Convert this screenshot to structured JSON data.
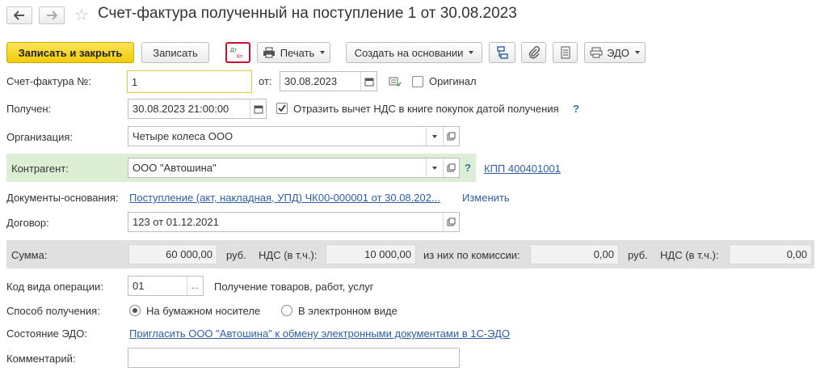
{
  "window": {
    "title": "Счет-фактура полученный на поступление 1 от 30.08.2023"
  },
  "toolbar": {
    "save_close": "Записать и закрыть",
    "save": "Записать",
    "dt_kt": "Дт Кт",
    "print": "Печать",
    "create_based": "Создать на основании",
    "edo": "ЭДО"
  },
  "form": {
    "invoice_number_label": "Счет-фактура №:",
    "invoice_number": "1",
    "from_label": "от:",
    "invoice_date": "30.08.2023",
    "original_label": "Оригинал",
    "original_checked": false,
    "received_label": "Получен:",
    "received_datetime": "30.08.2023 21:00:00",
    "vat_deduction_label": "Отразить вычет НДС в книге покупок датой получения",
    "vat_deduction_checked": true,
    "organization_label": "Организация:",
    "organization": "Четыре колеса ООО",
    "counterparty_label": "Контрагент:",
    "counterparty": "ООО \"Автошина\"",
    "kpp": "КПП 400401001",
    "basis_docs_label": "Документы-основания:",
    "basis_docs": "Поступление (акт, накладная, УПД) ЧК00-000001 от 30.08.202...",
    "change_label": "Изменить",
    "contract_label": "Договор:",
    "contract": "123 от 01.12.2021",
    "help_mark": "?"
  },
  "sums": {
    "sum_label": "Сумма:",
    "sum": "60 000,00",
    "currency": "руб.",
    "vat_label": "НДС (в т.ч.):",
    "vat": "10 000,00",
    "commission_label": "из них по комиссии:",
    "commission_sum": "0,00",
    "commission_currency": "руб.",
    "commission_vat_label": "НДС (в т.ч.):",
    "commission_vat": "0,00"
  },
  "operation": {
    "code_label": "Код вида операции:",
    "code": "01",
    "description": "Получение товаров, работ, услуг",
    "method_label": "Способ получения:",
    "paper": "На бумажном носителе",
    "electronic": "В электронном виде",
    "selected": "paper",
    "edo_state_label": "Состояние ЭДО:",
    "edo_invite": "Пригласить ООО \"Автошина\" к обмену электронными документами в 1С-ЭДО",
    "comment_label": "Комментарий:",
    "comment": ""
  },
  "colors": {
    "accent": "#f2cc06",
    "link": "#2d5fa8",
    "counterparty_bg": "#dcefd4",
    "sum_bg": "#e0e0e0",
    "dtkt_border": "#c8102e"
  }
}
